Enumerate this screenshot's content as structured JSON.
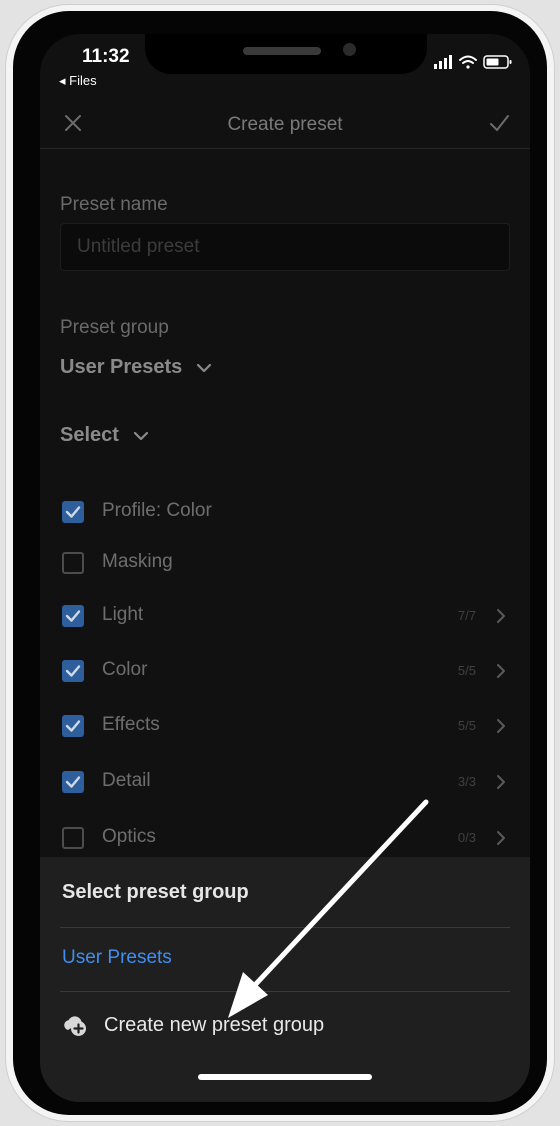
{
  "status_bar": {
    "time": "11:32",
    "back_label": "◂ Files"
  },
  "header": {
    "title": "Create preset"
  },
  "form": {
    "name_label": "Preset name",
    "name_placeholder": "Untitled preset",
    "group_label": "Preset group",
    "group_value": "User Presets",
    "select_label": "Select"
  },
  "categories": [
    {
      "label": "Profile: Color",
      "checked": true,
      "count": ""
    },
    {
      "label": "Masking",
      "checked": false,
      "count": ""
    },
    {
      "label": "Light",
      "checked": true,
      "count": "7/7"
    },
    {
      "label": "Color",
      "checked": true,
      "count": "5/5"
    },
    {
      "label": "Effects",
      "checked": true,
      "count": "5/5"
    },
    {
      "label": "Detail",
      "checked": true,
      "count": "3/3"
    },
    {
      "label": "Optics",
      "checked": false,
      "count": "0/3"
    }
  ],
  "sheet": {
    "title": "Select preset group",
    "option": "User Presets",
    "create_label": "Create new preset group"
  },
  "colors": {
    "accent": "#3f8ef0",
    "checkbox_checked": "#2e5e9c",
    "background": "#111111",
    "sheet_background": "#1f1f1f"
  },
  "icons": [
    "close-icon",
    "checkmark-icon",
    "chevron-down-icon",
    "chevron-right-icon",
    "cloud-add-icon",
    "signal-icon",
    "wifi-icon",
    "battery-icon"
  ]
}
